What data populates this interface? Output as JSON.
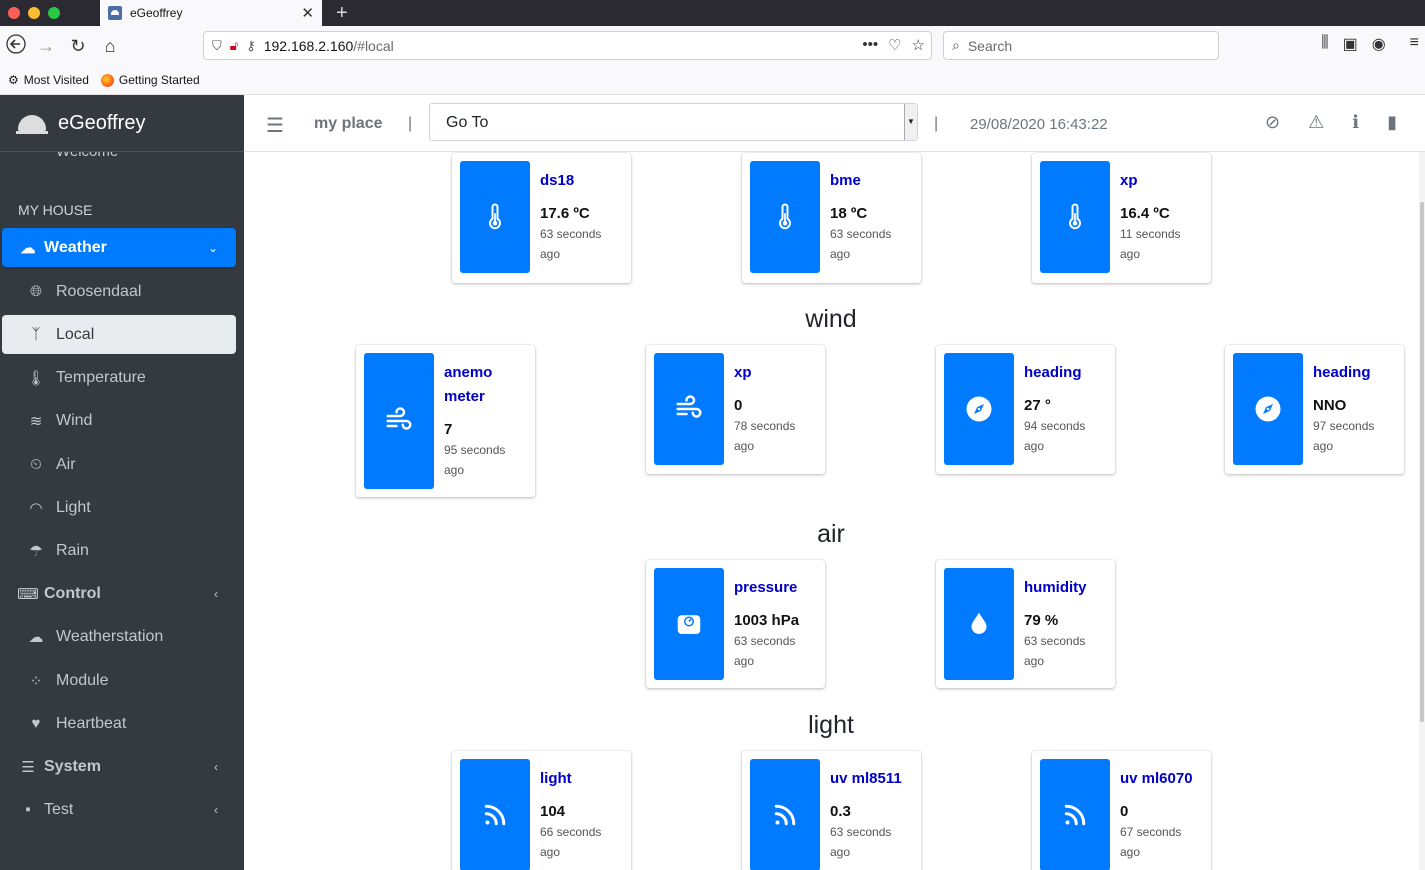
{
  "browser": {
    "tab_title": "eGeoffrey",
    "url_host": "192.168.2.160",
    "url_path": "/#local",
    "search_placeholder": "Search",
    "bookmarks": [
      "Most Visited",
      "Getting Started"
    ]
  },
  "sidebar": {
    "brand": "eGeoffrey",
    "welcome": "Welcome",
    "section": "MY HOUSE",
    "items": [
      {
        "label": "Weather",
        "icon": "cloud-sun-rain-icon"
      },
      {
        "label": "Roosendaal",
        "icon": "globe-icon"
      },
      {
        "label": "Local",
        "icon": "seedling-icon"
      },
      {
        "label": "Temperature",
        "icon": "thermometer-icon"
      },
      {
        "label": "Wind",
        "icon": "wind-icon"
      },
      {
        "label": "Air",
        "icon": "weight-icon"
      },
      {
        "label": "Light",
        "icon": "rss-icon"
      },
      {
        "label": "Rain",
        "icon": "cloud-rain-icon"
      },
      {
        "label": "Control",
        "icon": "keyboard-icon"
      },
      {
        "label": "Weatherstation",
        "icon": "cloud-sun-rain-icon"
      },
      {
        "label": "Module",
        "icon": "project-diagram-icon"
      },
      {
        "label": "Heartbeat",
        "icon": "heartbeat-icon"
      },
      {
        "label": "System",
        "icon": "server-icon"
      },
      {
        "label": "Test",
        "icon": "save-icon"
      }
    ]
  },
  "header": {
    "place": "my place",
    "goto": "Go To",
    "datetime": "29/08/2020 16:43:22"
  },
  "sections": {
    "wind": "wind",
    "air": "air",
    "light": "light"
  },
  "cards": {
    "ds18": {
      "name": "ds18",
      "value": "17.6 ºC",
      "ago1": "63 seconds",
      "ago2": "ago"
    },
    "bme": {
      "name": "bme",
      "value": "18 ºC",
      "ago1": "63 seconds",
      "ago2": "ago"
    },
    "xp_temp": {
      "name": "xp",
      "value": "16.4 ºC",
      "ago1": "11 seconds",
      "ago2": "ago"
    },
    "anemometer": {
      "name1": "anemo",
      "name2": "meter",
      "value": "7",
      "ago1": "95 seconds",
      "ago2": "ago"
    },
    "xp_wind": {
      "name": "xp",
      "value": "0",
      "ago1": "78 seconds",
      "ago2": "ago"
    },
    "heading1": {
      "name": "heading",
      "value": "27 °",
      "ago1": "94 seconds",
      "ago2": "ago"
    },
    "heading2": {
      "name": "heading",
      "value": "NNO",
      "ago1": "97 seconds",
      "ago2": "ago"
    },
    "pressure": {
      "name": "pressure",
      "value": "1003 hPa",
      "ago1": "63 seconds",
      "ago2": "ago"
    },
    "humidity": {
      "name": "humidity",
      "value": "79 %",
      "ago1": "63 seconds",
      "ago2": "ago"
    },
    "light": {
      "name": "light",
      "value": "104",
      "ago1": "66 seconds",
      "ago2": "ago"
    },
    "uv1": {
      "name": "uv ml8511",
      "value": "0.3",
      "ago1": "63 seconds",
      "ago2": "ago"
    },
    "uv2": {
      "name": "uv ml6070",
      "value": "0",
      "ago1": "67 seconds",
      "ago2": "ago"
    }
  },
  "colors": {
    "accent": "#007bff",
    "sidebar_bg": "#343a40",
    "card_name": "#0000c8"
  }
}
